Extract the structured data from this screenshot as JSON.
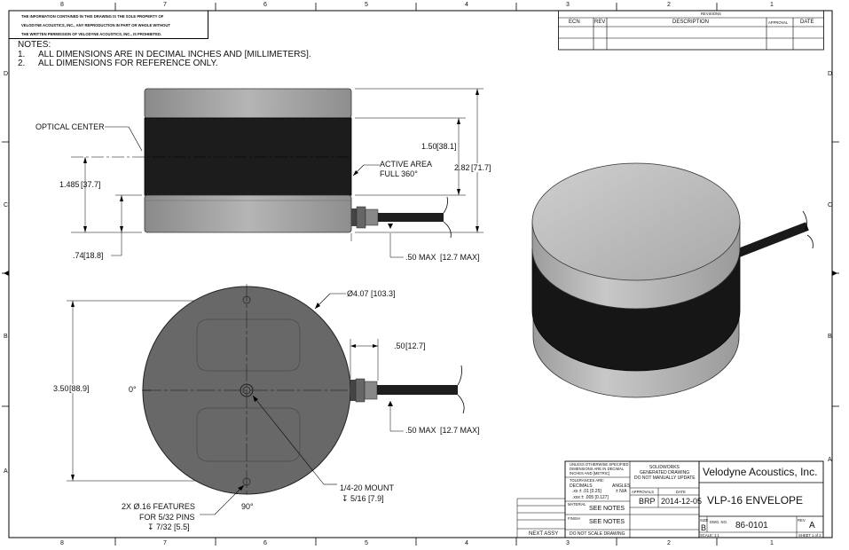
{
  "notice": {
    "line1": "THE INFORMATION CONTAINED IN THIS DRAWING IS THE SOLE PROPERTY OF",
    "line2": "VELODYNE ACOUSTICS, INC., ANY REPRODUCTION IN PART OR WHOLE WITHOUT",
    "line3": "THE WRITTEN PERMISSION OF VELODYNE ACOUSTICS, INC., IS PROHIBITED."
  },
  "notes": {
    "heading": "NOTES:",
    "items": [
      {
        "num": "1.",
        "text": "ALL DIMENSIONS ARE IN DECIMAL INCHES AND [MILLIMETERS]."
      },
      {
        "num": "2.",
        "text": "ALL DIMENSIONS FOR REFERENCE ONLY."
      }
    ]
  },
  "border": {
    "columns": [
      "8",
      "7",
      "6",
      "5",
      "4",
      "3",
      "2",
      "1"
    ],
    "rows": [
      "D",
      "C",
      "B",
      "A"
    ]
  },
  "revisions": {
    "title": "REVISIONS",
    "headers": {
      "ecn": "ECN",
      "rev": "REV",
      "description": "DESCRIPTION",
      "approval": "APPROVAL",
      "date": "DATE"
    }
  },
  "side_view": {
    "optical_center": "OPTICAL CENTER",
    "active_area_1": "ACTIVE AREA",
    "active_area_2": "FULL 360°",
    "dim_150": "1.50",
    "dim_150_mm": "38.1",
    "dim_282": "2.82",
    "dim_282_mm": "71.7",
    "dim_1485": "1.485",
    "dim_1485_mm": "37.7",
    "dim_74": ".74",
    "dim_74_mm": "18.8",
    "dim_50max": ".50 MAX",
    "dim_50max_mm": "12.7 MAX"
  },
  "top_view": {
    "diameter": "Ø4.07",
    "diameter_mm": "103.3",
    "dim_350": "3.50",
    "dim_350_mm": "88.9",
    "angle_0": "0°",
    "angle_90": "90°",
    "dim_50": ".50",
    "dim_50_mm": "12.7",
    "dim_50max": ".50 MAX",
    "dim_50max_mm": "12.7 MAX",
    "mount_1": "1/4-20 MOUNT",
    "mount_2": "↧ 5/16 [7.9]",
    "features_1": "2X Ø.16 FEATURES",
    "features_2": "FOR 5/32 PINS",
    "features_3": "↧ 7/32 [5.5]"
  },
  "title_block": {
    "tol_1": "UNLESS OTHERWISE SPECIFIED",
    "tol_2": "DIMENSIONS ARE IN DECIMAL",
    "tol_3": "INCHES AND [METRIC]",
    "tol_4": "TOLERANCES ARE:",
    "decimals": "DECIMALS",
    "angles": "ANGLES",
    "tol_xx": ".xx ± .01 [0.25]",
    "tol_xxx": ".xxx ± .005 [0.127]",
    "tol_angle": "± N/A",
    "solidworks_1": "SOLIDWORKS",
    "solidworks_2": "GENERATED DRAWING",
    "solidworks_3": "DO NOT MANUALLY UPDATE",
    "approvals": "APPROVALS",
    "date_label": "DATE",
    "approver": "BRP",
    "approval_date": "2014-12-05",
    "material_label": "MATERIAL",
    "material_value": "SEE NOTES",
    "finish_label": "FINISH",
    "finish_value": "SEE NOTES",
    "next_assy": "NEXT ASSY",
    "do_not_scale": "DO NOT SCALE DRAWING",
    "company": "Velodyne Acoustics, Inc.",
    "drawing_title": "VLP-16 ENVELOPE",
    "size_label": "SIZE",
    "size_value": "B",
    "dwg_no_label": "DWG. NO.",
    "dwg_no": "86-0101",
    "rev_label": "REV.",
    "rev_value": "A",
    "scale": "SCALE: 1:1",
    "sheet": "SHEET 1 of 2"
  }
}
